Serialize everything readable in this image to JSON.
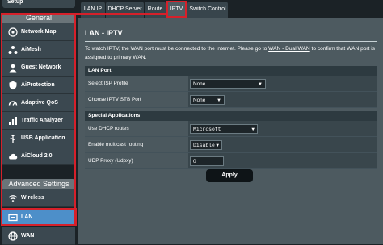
{
  "sidebar": {
    "top_item": "Setup",
    "general_header": "General",
    "general_items": [
      {
        "label": "Network Map",
        "icon": "network-map-icon"
      },
      {
        "label": "AiMesh",
        "icon": "aimesh-icon"
      },
      {
        "label": "Guest Network",
        "icon": "guest-network-icon"
      },
      {
        "label": "AiProtection",
        "icon": "aiprotection-icon"
      },
      {
        "label": "Adaptive QoS",
        "icon": "adaptive-qos-icon"
      },
      {
        "label": "Traffic Analyzer",
        "icon": "traffic-analyzer-icon"
      },
      {
        "label": "USB Application",
        "icon": "usb-application-icon"
      },
      {
        "label": "AiCloud 2.0",
        "icon": "aicloud-icon"
      }
    ],
    "advanced_header": "Advanced Settings",
    "advanced_items": [
      {
        "label": "Wireless",
        "icon": "wireless-icon"
      },
      {
        "label": "LAN",
        "icon": "lan-icon",
        "active": true
      },
      {
        "label": "WAN",
        "icon": "wan-icon"
      }
    ]
  },
  "tabs": [
    {
      "label": "LAN IP"
    },
    {
      "label": "DHCP Server"
    },
    {
      "label": "Route"
    },
    {
      "label": "IPTV",
      "active": true
    },
    {
      "label": "Switch Control"
    }
  ],
  "page": {
    "title": "LAN - IPTV",
    "desc_part1": "To watch IPTV, the WAN port must be connected to the Internet. Please go to ",
    "desc_link": "WAN - Dual WAN",
    "desc_part2": " to confirm that WAN port is assigned to primary WAN."
  },
  "lan_port": {
    "header": "LAN Port",
    "isp_profile_label": "Select ISP Profile",
    "isp_profile_value": "None",
    "stb_port_label": "Choose IPTV STB Port",
    "stb_port_value": "None"
  },
  "special": {
    "header": "Special Applications",
    "dhcp_routes_label": "Use DHCP routes",
    "dhcp_routes_value": "Microsoft",
    "multicast_label": "Enable multicast routing",
    "multicast_value": "Disable",
    "udp_proxy_label": "UDP Proxy (Udpxy)",
    "udp_proxy_value": "0"
  },
  "apply_label": "Apply",
  "colors": {
    "highlight": "#d6202a",
    "active_item": "#4d8fc9"
  }
}
